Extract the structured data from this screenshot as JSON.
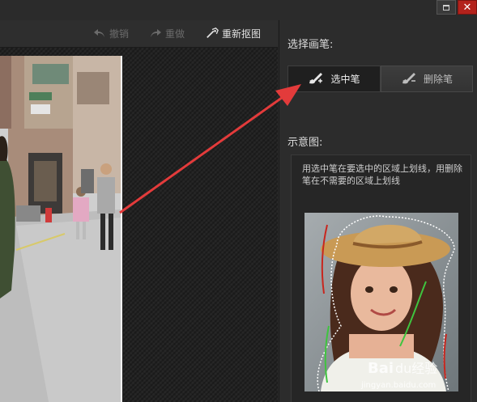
{
  "toolbar": {
    "undo_label": "撤销",
    "redo_label": "重做",
    "recut_label": "重新抠图"
  },
  "panel": {
    "pen_title": "选择画笔:",
    "pen_select_label": "选中笔",
    "pen_delete_label": "删除笔",
    "demo_title": "示意图:",
    "demo_description": "用选中笔在要选中的区域上划线，用删除笔在不需要的区域上划线"
  },
  "watermark": {
    "brand": "Baidu经验",
    "url": "jingyan.baidu.com"
  },
  "colors": {
    "close_button": "#b3221c",
    "annotation_arrow": "#e33b3b",
    "select_stroke": "#3fc43f",
    "delete_stroke": "#c8261e"
  },
  "icons": {
    "undo": "undo-arrow-icon",
    "redo": "redo-arrow-icon",
    "recut": "wand-icon",
    "pen_select": "select-brush-icon",
    "pen_delete": "delete-brush-icon"
  }
}
